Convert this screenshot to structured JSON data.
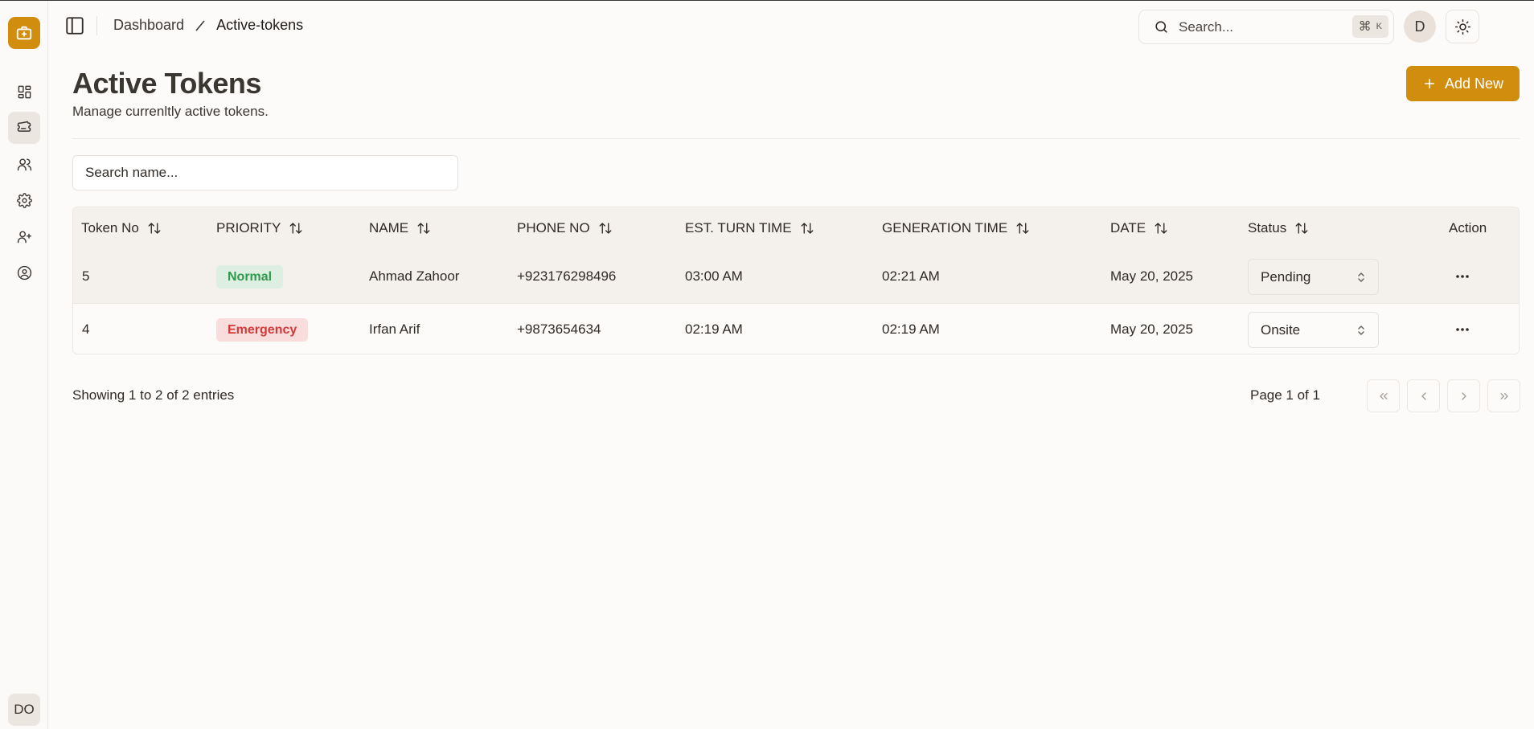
{
  "sidebar": {
    "logo_icon": "briefcase-medical-icon",
    "items": [
      {
        "name": "dashboard",
        "icon": "dashboard-grid-icon"
      },
      {
        "name": "tokens",
        "icon": "ticket-icon",
        "active": true
      },
      {
        "name": "users",
        "icon": "users-icon"
      },
      {
        "name": "settings",
        "icon": "gear-icon"
      },
      {
        "name": "add-user",
        "icon": "user-plus-icon"
      },
      {
        "name": "account",
        "icon": "user-circle-icon"
      }
    ],
    "user_initials": "DO"
  },
  "header": {
    "breadcrumb": [
      "Dashboard",
      "Active-tokens"
    ],
    "search_placeholder": "Search...",
    "shortcut_symbol": "⌘",
    "shortcut_key": "K",
    "avatar_initial": "D"
  },
  "page": {
    "title": "Active Tokens",
    "subtitle": "Manage currenltly active tokens.",
    "add_button_label": "Add New",
    "name_search_placeholder": "Search name..."
  },
  "table": {
    "columns": [
      "Token No",
      "PRIORITY",
      "NAME",
      "PHONE NO",
      "EST. TURN TIME",
      "GENERATION TIME",
      "DATE",
      "Status",
      "Action"
    ],
    "rows": [
      {
        "token_no": "5",
        "priority": "Normal",
        "name": "Ahmad Zahoor",
        "phone": "+923176298496",
        "est_turn_time": "03:00 AM",
        "generation_time": "02:21 AM",
        "date": "May 20, 2025",
        "status": "Pending"
      },
      {
        "token_no": "4",
        "priority": "Emergency",
        "name": "Irfan Arif",
        "phone": "+9873654634",
        "est_turn_time": "02:19 AM",
        "generation_time": "02:19 AM",
        "date": "May 20, 2025",
        "status": "Onsite"
      }
    ]
  },
  "footer": {
    "showing": "Showing 1 to 2 of 2 entries",
    "page_info": "Page 1 of 1"
  },
  "colors": {
    "accent": "#d18d0e",
    "normal_badge_bg": "#dcefe0",
    "normal_badge_text": "#2f9a4e",
    "emergency_badge_bg": "#f9dcdc",
    "emergency_badge_text": "#d23a3a"
  }
}
